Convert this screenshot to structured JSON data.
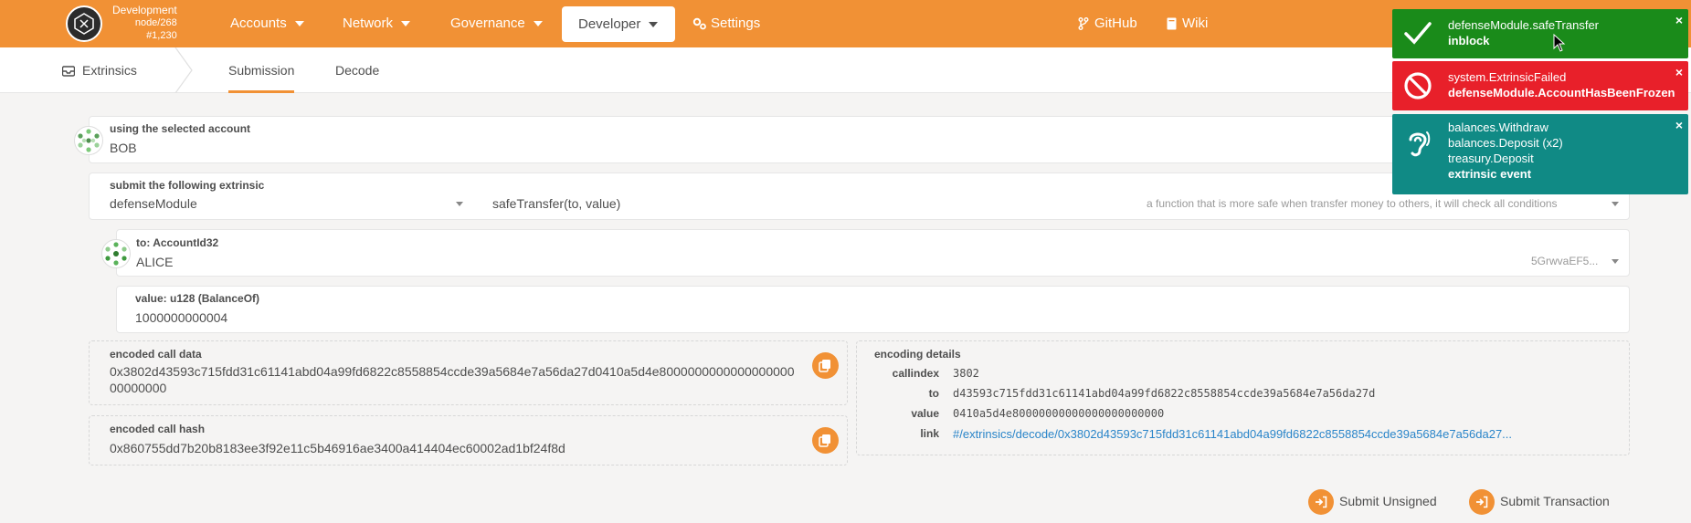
{
  "header": {
    "chain_name": "Development",
    "node": "node/268",
    "block": "#1,230",
    "nav": [
      "Accounts",
      "Network",
      "Governance"
    ],
    "nav_active": "Developer",
    "settings": "Settings",
    "github": "GitHub",
    "wiki": "Wiki",
    "accent": "#f19135"
  },
  "subnav": {
    "section": "Extrinsics",
    "tabs": [
      "Submission",
      "Decode"
    ],
    "active_tab": "Submission"
  },
  "account": {
    "label": "using the selected account",
    "value": "BOB"
  },
  "extrinsic": {
    "label": "submit the following extrinsic",
    "module": "defenseModule",
    "method": "safeTransfer(to, value)",
    "description": "a function that is more safe when transfer money to others, it will check all conditions"
  },
  "param_to": {
    "label": "to: AccountId32",
    "value": "ALICE",
    "address": "5GrwvaEF5..."
  },
  "param_value": {
    "label": "value: u128 (BalanceOf)",
    "value": "1000000000004"
  },
  "encoded_call_data": {
    "label": "encoded call data",
    "line1": "0x3802d43593c715fdd31c61141abd04a99fd6822c8558854ccde39a5684e7a56da27d0410a5d4e8000000000000000000",
    "line2": "00000000"
  },
  "encoded_call_hash": {
    "label": "encoded call hash",
    "value": "0x860755dd7b20b8183ee3f92e11c5b46916ae3400a414404ec60002ad1bf24f8d"
  },
  "encoding_details": {
    "label": "encoding details",
    "rows": [
      {
        "key": "callindex",
        "value": "3802"
      },
      {
        "key": "to",
        "value": "d43593c715fdd31c61141abd04a99fd6822c8558854ccde39a5684e7a56da27d"
      },
      {
        "key": "value",
        "value": "0410a5d4e80000000000000000000000"
      },
      {
        "key": "link",
        "value": "#/extrinsics/decode/0x3802d43593c715fdd31c61141abd04a99fd6822c8558854ccde39a5684e7a56da27..."
      }
    ],
    "link_color": "#2a85c9"
  },
  "actions": {
    "submit_unsigned": "Submit Unsigned",
    "submit_transaction": "Submit Transaction"
  },
  "toasts": [
    {
      "icon": "check-icon",
      "line1": "defenseModule.safeTransfer",
      "line2": "inblock",
      "color": "#1a8b1a"
    },
    {
      "icon": "blocked-icon",
      "line1": "system.ExtrinsicFailed",
      "line2": "defenseModule.AccountHasBeenFrozen",
      "color": "#e8202a"
    },
    {
      "icon": "hearing-icon",
      "line1": "balances.Withdraw",
      "line2": "balances.Deposit (x2)",
      "line3": "treasury.Deposit",
      "line4": "extrinsic event",
      "color": "#108a85"
    }
  ],
  "toast_close": "×"
}
